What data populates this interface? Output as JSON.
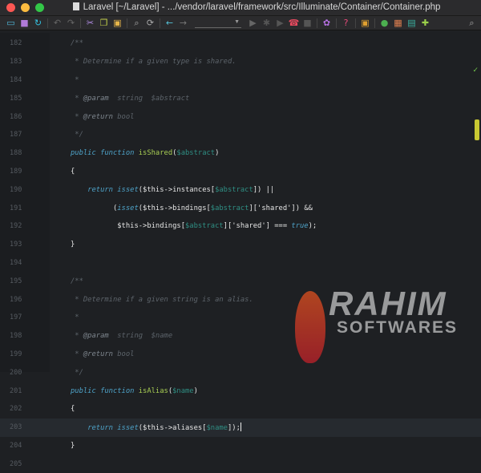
{
  "window": {
    "title": "Laravel [~/Laravel] - .../vendor/laravel/framework/src/Illuminate/Container/Container.php"
  },
  "toolbar": {
    "icons": [
      {
        "name": "open-folder-icon",
        "glyph": "▭",
        "color": "#4fb6d8"
      },
      {
        "name": "save-icon",
        "glyph": "■",
        "color": "#b07ad8"
      },
      {
        "name": "sync-icon",
        "glyph": "↻",
        "color": "#33c1e0"
      },
      {
        "sep": true
      },
      {
        "name": "undo-icon",
        "glyph": "↶",
        "color": "#666"
      },
      {
        "name": "redo-icon",
        "glyph": "↷",
        "color": "#666"
      },
      {
        "sep": true
      },
      {
        "name": "cut-icon",
        "glyph": "✂",
        "color": "#b48ee8"
      },
      {
        "name": "copy-icon",
        "glyph": "❐",
        "color": "#c4d24a"
      },
      {
        "name": "paste-icon",
        "glyph": "▣",
        "color": "#e6b54a"
      },
      {
        "sep": true
      },
      {
        "name": "find-icon",
        "glyph": "⌕",
        "color": "#aaa"
      },
      {
        "name": "replace-icon",
        "glyph": "⟳",
        "color": "#aaa"
      },
      {
        "sep": true
      },
      {
        "name": "back-icon",
        "glyph": "←",
        "color": "#56c3d8"
      },
      {
        "name": "forward-icon",
        "glyph": "→",
        "color": "#777"
      },
      {
        "combo": true
      },
      {
        "name": "run-icon",
        "glyph": "▶",
        "color": "#666"
      },
      {
        "name": "debug-icon",
        "glyph": "✱",
        "color": "#555"
      },
      {
        "name": "run-coverage-icon",
        "glyph": "▶",
        "color": "#555"
      },
      {
        "name": "phone-listen-icon",
        "glyph": "☎",
        "color": "#e84a5f"
      },
      {
        "name": "stop-icon",
        "glyph": "■",
        "color": "#555"
      },
      {
        "sep": true
      },
      {
        "name": "settings-icon",
        "glyph": "✿",
        "color": "#b470e0"
      },
      {
        "sep": true
      },
      {
        "name": "help-icon",
        "glyph": "?",
        "color": "#e84a7a"
      },
      {
        "sep": true
      },
      {
        "name": "cpu-icon",
        "glyph": "▣",
        "color": "#e0a030"
      },
      {
        "sep": true
      },
      {
        "name": "vcs-icon",
        "glyph": "●",
        "color": "#4caf50"
      },
      {
        "name": "layout-icon",
        "glyph": "▦",
        "color": "#e08050"
      },
      {
        "name": "database-icon",
        "glyph": "▤",
        "color": "#3ab0a0"
      },
      {
        "name": "plugin-icon",
        "glyph": "✚",
        "color": "#9bd04a"
      }
    ],
    "search_icon": "⌕",
    "combo_arrow": "▼"
  },
  "editor": {
    "current_line": 203,
    "lines": [
      {
        "n": 182,
        "t": [
          [
            "comment",
            "/**"
          ]
        ]
      },
      {
        "n": 183,
        "t": [
          [
            "comment",
            " * Determine if a given type is shared."
          ]
        ]
      },
      {
        "n": 184,
        "t": [
          [
            "comment",
            " *"
          ]
        ]
      },
      {
        "n": 185,
        "t": [
          [
            "comment",
            " * "
          ],
          [
            "doctag",
            "@param"
          ],
          [
            "comment",
            "  string  $abstract"
          ]
        ]
      },
      {
        "n": 186,
        "t": [
          [
            "comment",
            " * "
          ],
          [
            "doctag",
            "@return"
          ],
          [
            "comment",
            " bool"
          ]
        ]
      },
      {
        "n": 187,
        "t": [
          [
            "comment",
            " */"
          ]
        ]
      },
      {
        "n": 188,
        "t": [
          [
            "kw",
            "public function "
          ],
          [
            "fn",
            "isShared"
          ],
          [
            "str",
            "("
          ],
          [
            "var",
            "$abstract"
          ],
          [
            "str",
            ")"
          ]
        ]
      },
      {
        "n": 189,
        "t": [
          [
            "str",
            "{"
          ]
        ]
      },
      {
        "n": 190,
        "t": [
          [
            "str",
            "    "
          ],
          [
            "kw",
            "return isset"
          ],
          [
            "str",
            "($this->instances["
          ],
          [
            "var",
            "$abstract"
          ],
          [
            "str",
            "]) ||"
          ]
        ]
      },
      {
        "n": 191,
        "t": [
          [
            "str",
            "          ("
          ],
          [
            "kw",
            "isset"
          ],
          [
            "str",
            "($this->bindings["
          ],
          [
            "var",
            "$abstract"
          ],
          [
            "str",
            "]['shared']) &&"
          ]
        ]
      },
      {
        "n": 192,
        "t": [
          [
            "str",
            "           $this->bindings["
          ],
          [
            "var",
            "$abstract"
          ],
          [
            "str",
            "]['shared'] === "
          ],
          [
            "kw",
            "true"
          ],
          [
            "str",
            ");"
          ]
        ]
      },
      {
        "n": 193,
        "t": [
          [
            "str",
            "}"
          ]
        ]
      },
      {
        "n": 194,
        "t": []
      },
      {
        "n": 195,
        "t": [
          [
            "comment",
            "/**"
          ]
        ]
      },
      {
        "n": 196,
        "t": [
          [
            "comment",
            " * Determine if a given string is an alias."
          ]
        ]
      },
      {
        "n": 197,
        "t": [
          [
            "comment",
            " *"
          ]
        ]
      },
      {
        "n": 198,
        "t": [
          [
            "comment",
            " * "
          ],
          [
            "doctag",
            "@param"
          ],
          [
            "comment",
            "  string  $name"
          ]
        ]
      },
      {
        "n": 199,
        "t": [
          [
            "comment",
            " * "
          ],
          [
            "doctag",
            "@return"
          ],
          [
            "comment",
            " bool"
          ]
        ]
      },
      {
        "n": 200,
        "t": [
          [
            "comment",
            " */"
          ]
        ]
      },
      {
        "n": 201,
        "t": [
          [
            "kw",
            "public function "
          ],
          [
            "fn",
            "isAlias"
          ],
          [
            "str",
            "("
          ],
          [
            "var",
            "$name"
          ],
          [
            "str",
            ")"
          ]
        ]
      },
      {
        "n": 202,
        "t": [
          [
            "str",
            "{"
          ]
        ]
      },
      {
        "n": 203,
        "t": [
          [
            "str",
            "    "
          ],
          [
            "kw",
            "return isset"
          ],
          [
            "str",
            "($this->aliases["
          ],
          [
            "var",
            "$name"
          ],
          [
            "str",
            "]);"
          ]
        ]
      },
      {
        "n": 204,
        "t": [
          [
            "str",
            "}"
          ]
        ]
      },
      {
        "n": 205,
        "t": []
      }
    ]
  },
  "status": {
    "check_icon": "✓"
  },
  "watermark": {
    "line1": "RAHIM",
    "line2": "SOFTWARES"
  }
}
